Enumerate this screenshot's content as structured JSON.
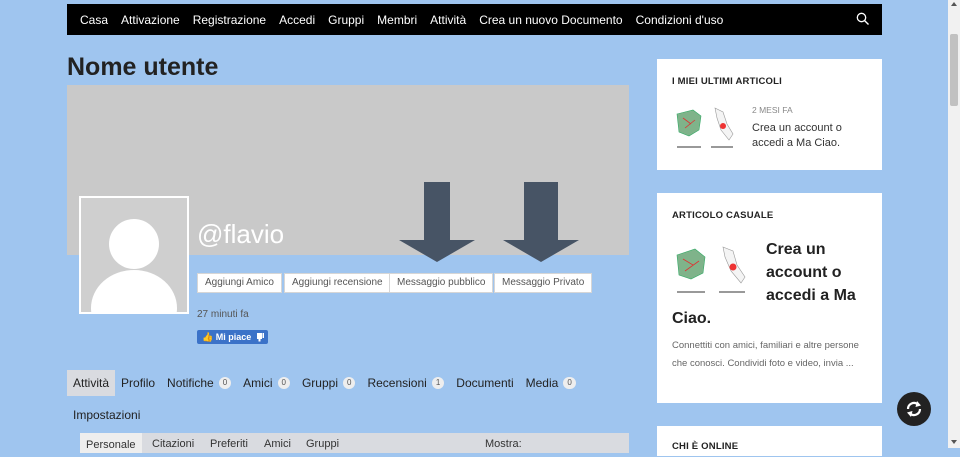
{
  "nav": {
    "items": [
      "Casa",
      "Attivazione",
      "Registrazione",
      "Accedi",
      "Gruppi",
      "Membri",
      "Attività",
      "Crea un nuovo Documento",
      "Condizioni d'uso"
    ]
  },
  "profile": {
    "page_title": "Nome utente",
    "handle": "@flavio",
    "buttons": {
      "add_friend": "Aggiungi Amico",
      "add_review": "Aggiungi recensione",
      "public_message": "Messaggio pubblico",
      "private_message": "Messaggio Privato"
    },
    "last_active": "27 minuti fa",
    "like_label": "Mi piace"
  },
  "tabs": [
    {
      "label": "Attività"
    },
    {
      "label": "Profilo"
    },
    {
      "label": "Notifiche",
      "count": "0"
    },
    {
      "label": "Amici",
      "count": "0"
    },
    {
      "label": "Gruppi",
      "count": "0"
    },
    {
      "label": "Recensioni",
      "count": "1"
    },
    {
      "label": "Documenti"
    },
    {
      "label": "Media",
      "count": "0"
    },
    {
      "label": "Impostazioni"
    }
  ],
  "subtabs": {
    "items": [
      "Personale",
      "Citazioni",
      "Preferiti",
      "Amici",
      "Gruppi"
    ],
    "show_label": "Mostra:"
  },
  "sidebar": {
    "recent": {
      "title": "I MIEI ULTIMI ARTICOLI",
      "date": "2 MESI FA",
      "post_title": "Crea un account o accedi a Ma Ciao."
    },
    "random": {
      "title": "ARTICOLO CASUALE",
      "post_title_lines": [
        "Crea un",
        "account o",
        "accedi a Ma",
        "Ciao."
      ],
      "excerpt": "Connettiti con amici, familiari e altre persone che conosci. Condividi foto e video, invia ..."
    },
    "online": {
      "title": "CHI È ONLINE"
    }
  }
}
